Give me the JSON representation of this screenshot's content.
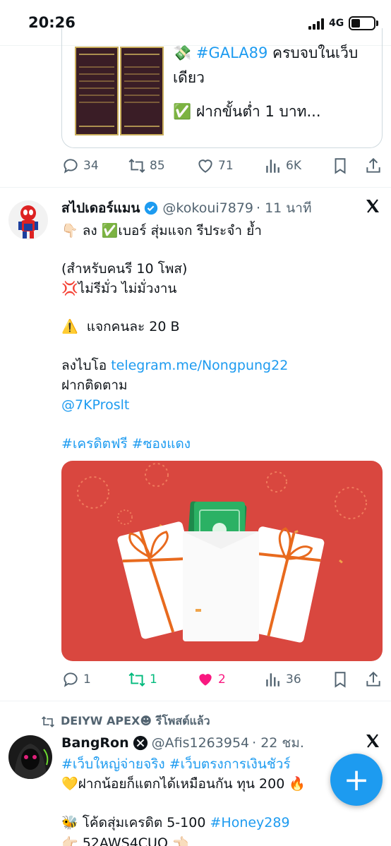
{
  "status": {
    "time": "20:26",
    "network": "4G"
  },
  "tweet1": {
    "card_line1_hashtag": "#GALA89",
    "card_line1_rest": " ครบจบในเว็บ",
    "card_line2": "เดียว",
    "card_line3": "ฝากขั้นต่ำ 1 บาท...",
    "actions": {
      "replies": "34",
      "retweets": "85",
      "likes": "71",
      "views": "6K"
    }
  },
  "tweet2": {
    "name": "สไปเดอร์แมน",
    "handle": "@kokoui7879",
    "time": "· 11 นาที",
    "lines": {
      "l1": "ลง ✅เบอร์ สุ่มแจก  รีประจำ ย้ำ",
      "l2": "(สำหรับคนรี 10 โพส)",
      "l3": "ไม่รีมั่ว ไม่มั่วงาน",
      "l4": "แจกคนละ 20  B",
      "l5_prefix": "ลงไบโอ ",
      "l5_link": "telegram.me/Nongpung22",
      "l6": "ฝากติดตาม",
      "l7": "@7KProslt",
      "l8": "#เครดิตฟรี #ซองแดง"
    },
    "actions": {
      "replies": "1",
      "retweets": "1",
      "likes": "2",
      "views": "36"
    }
  },
  "tweet3": {
    "retweeted_by": "DEIYW APEX☻ รีโพสต์แล้ว",
    "name": "BangRon",
    "handle": "@Afis1263954",
    "time": "· 22 ชม.",
    "line1": "#เว็บใหญ่จ่ายจริง #เว็บตรงการเงินชัวร์",
    "line2": "ฝากน้อยก็แตกได้เหมือนกัน ทุน 200",
    "line3_prefix": "โค้ดสุ่มเครดิต 5-100 ",
    "line3_hashtag": "#Honey289",
    "line4": "52AWS4CUO"
  },
  "fab_label": "+",
  "colors": {
    "accent": "#1d9bf0",
    "like": "#f91880",
    "retweet": "#00ba7c",
    "envelope_bg": "#d9473f"
  },
  "icons": [
    "reply-icon",
    "retweet-icon",
    "like-icon",
    "views-icon",
    "bookmark-icon",
    "share-icon",
    "verified-icon",
    "x-logo-icon"
  ]
}
